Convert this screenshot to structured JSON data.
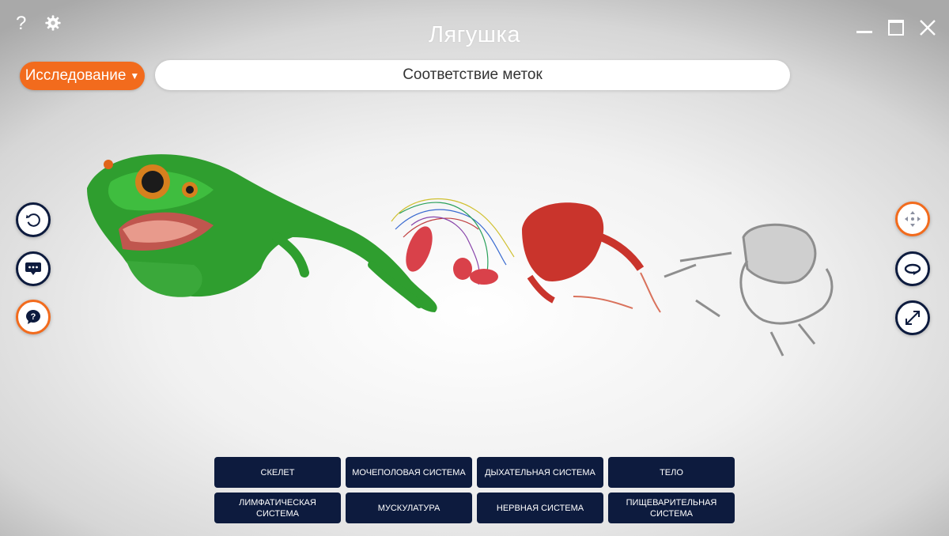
{
  "window": {
    "title": "Лягушка",
    "help_label": "?"
  },
  "toolbar": {
    "mode_label": "Исследование",
    "label_bar_text": "Соответствие меток"
  },
  "colors": {
    "accent": "#f26b1d",
    "navy": "#0d1b3e",
    "white": "#ffffff"
  },
  "left_controls": [
    {
      "icon": "reset-view-icon"
    },
    {
      "icon": "chat-bubble-icon"
    },
    {
      "icon": "question-bubble-icon",
      "active": true
    }
  ],
  "right_controls": [
    {
      "icon": "move-arrows-icon",
      "active": true
    },
    {
      "icon": "rotate-icon"
    },
    {
      "icon": "expand-icon"
    }
  ],
  "systems": [
    {
      "label": "Скелет"
    },
    {
      "label": "Мочеполовая система"
    },
    {
      "label": "Дыхательная система"
    },
    {
      "label": "Тело"
    },
    {
      "label": "Лимфатическая система"
    },
    {
      "label": "Мускулатура"
    },
    {
      "label": "Нервная система"
    },
    {
      "label": "Пищеварительная система"
    }
  ]
}
